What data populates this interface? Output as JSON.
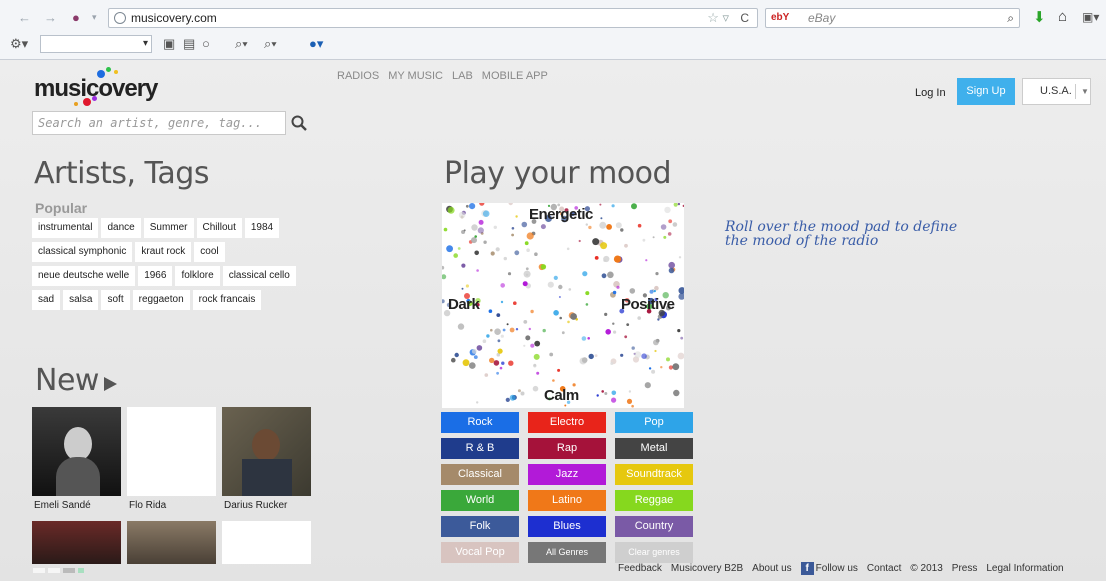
{
  "browser": {
    "url": "musicovery.com",
    "search_placeholder": "eBay",
    "search_engine_badge": "ebY"
  },
  "header": {
    "logo": "musicovery",
    "search_placeholder": "Search an artist, genre, tag...",
    "nav": [
      "RADIOS",
      "MY MUSIC",
      "LAB",
      "MOBILE APP"
    ],
    "login": "Log In",
    "signup": "Sign Up",
    "country": "U.S.A."
  },
  "artists": {
    "title": "Artists, Tags",
    "popular_label": "Popular",
    "tag_rows": [
      [
        "instrumental",
        "dance",
        "Summer",
        "Chillout",
        "1984"
      ],
      [
        "classical symphonic",
        "kraut rock",
        "cool"
      ],
      [
        "neue deutsche welle",
        "1966",
        "folklore",
        "classical cello"
      ],
      [
        "sad",
        "salsa",
        "soft",
        "reggaeton",
        "rock francais"
      ]
    ]
  },
  "new_section": {
    "title": "New",
    "albums": [
      {
        "name": "Emeli Sandé",
        "art": "dark"
      },
      {
        "name": "Flo Rida",
        "art": "blank"
      },
      {
        "name": "Darius Rucker",
        "art": "photo"
      },
      {
        "name": "",
        "art": "dark-red"
      },
      {
        "name": "",
        "art": "sepia"
      },
      {
        "name": "",
        "art": "blank"
      }
    ]
  },
  "mood": {
    "title": "Play your mood",
    "labels": {
      "top": "Energetic",
      "left": "Dark",
      "right": "Positive",
      "bottom": "Calm"
    },
    "hint_line1": "Roll over the mood pad to define",
    "hint_line2": "the mood of the radio"
  },
  "genres": [
    {
      "label": "Rock",
      "color": "#1a6ee6"
    },
    {
      "label": "Electro",
      "color": "#e8241a"
    },
    {
      "label": "Pop",
      "color": "#2ea4e8"
    },
    {
      "label": "R & B",
      "color": "#1f3c8c"
    },
    {
      "label": "Rap",
      "color": "#a5123a"
    },
    {
      "label": "Metal",
      "color": "#444444"
    },
    {
      "label": "Classical",
      "color": "#a58a6a"
    },
    {
      "label": "Jazz",
      "color": "#b21ad8"
    },
    {
      "label": "Soundtrack",
      "color": "#e6c80e"
    },
    {
      "label": "World",
      "color": "#3aa83a"
    },
    {
      "label": "Latino",
      "color": "#f07818"
    },
    {
      "label": "Reggae",
      "color": "#86d81e"
    },
    {
      "label": "Folk",
      "color": "#3c5a9a"
    },
    {
      "label": "Blues",
      "color": "#1d2fd0"
    },
    {
      "label": "Country",
      "color": "#7a5aa6"
    },
    {
      "label": "Vocal Pop",
      "color": "#d8c4c0"
    },
    {
      "label": "All Genres",
      "color": "#777777"
    },
    {
      "label": "Clear genres",
      "color": "#cfcfcf"
    }
  ],
  "footer": {
    "links": [
      "Feedback",
      "Musicovery B2B",
      "About us",
      "Follow us",
      "Contact",
      "© 2013",
      "Press",
      "Legal Information"
    ]
  }
}
